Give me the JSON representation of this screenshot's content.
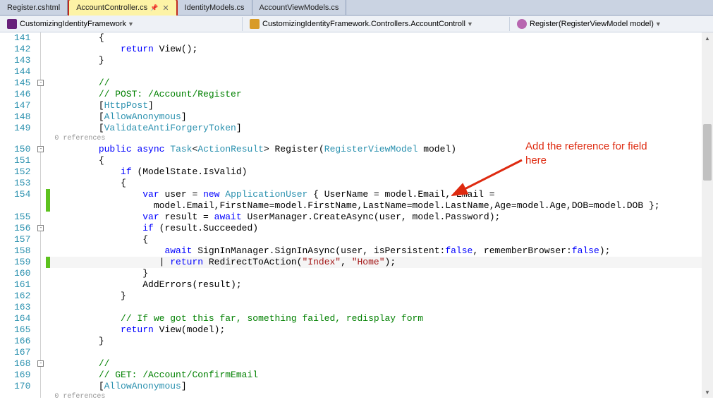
{
  "tabs": [
    {
      "label": "Register.cshtml",
      "active": false
    },
    {
      "label": "AccountController.cs",
      "active": true,
      "pinned": true
    },
    {
      "label": "IdentityModels.cs",
      "active": false
    },
    {
      "label": "AccountViewModels.cs",
      "active": false
    }
  ],
  "nav": {
    "project": "CustomizingIdentityFramework",
    "class": "CustomizingIdentityFramework.Controllers.AccountControll",
    "member": "Register(RegisterViewModel model)"
  },
  "annotation": {
    "line1": "Add the reference for field",
    "line2": "here"
  },
  "lines": [
    {
      "num": 141,
      "code": [
        {
          "t": "n",
          "v": "        {"
        }
      ]
    },
    {
      "num": 142,
      "code": [
        {
          "t": "n",
          "v": "            "
        },
        {
          "t": "k",
          "v": "return"
        },
        {
          "t": "n",
          "v": " View();"
        }
      ]
    },
    {
      "num": 143,
      "code": [
        {
          "t": "n",
          "v": "        }"
        }
      ]
    },
    {
      "num": 144,
      "code": [
        {
          "t": "n",
          "v": ""
        }
      ]
    },
    {
      "num": 145,
      "fold": "-",
      "code": [
        {
          "t": "n",
          "v": "        "
        },
        {
          "t": "c",
          "v": "//"
        }
      ]
    },
    {
      "num": 146,
      "code": [
        {
          "t": "n",
          "v": "        "
        },
        {
          "t": "c",
          "v": "// POST: /Account/Register"
        }
      ]
    },
    {
      "num": 147,
      "code": [
        {
          "t": "n",
          "v": "        ["
        },
        {
          "t": "t",
          "v": "HttpPost"
        },
        {
          "t": "n",
          "v": "]"
        }
      ]
    },
    {
      "num": 148,
      "code": [
        {
          "t": "n",
          "v": "        ["
        },
        {
          "t": "t",
          "v": "AllowAnonymous"
        },
        {
          "t": "n",
          "v": "]"
        }
      ]
    },
    {
      "num": 149,
      "code": [
        {
          "t": "n",
          "v": "        ["
        },
        {
          "t": "t",
          "v": "ValidateAntiForgeryToken"
        },
        {
          "t": "n",
          "v": "]"
        }
      ]
    },
    {
      "refs": "0 references"
    },
    {
      "num": 150,
      "fold": "-",
      "code": [
        {
          "t": "n",
          "v": "        "
        },
        {
          "t": "k",
          "v": "public"
        },
        {
          "t": "n",
          "v": " "
        },
        {
          "t": "k",
          "v": "async"
        },
        {
          "t": "n",
          "v": " "
        },
        {
          "t": "t",
          "v": "Task"
        },
        {
          "t": "n",
          "v": "<"
        },
        {
          "t": "t",
          "v": "ActionResult"
        },
        {
          "t": "n",
          "v": "> Register("
        },
        {
          "t": "t",
          "v": "RegisterViewModel"
        },
        {
          "t": "n",
          "v": " model)"
        }
      ]
    },
    {
      "num": 151,
      "code": [
        {
          "t": "n",
          "v": "        {"
        }
      ]
    },
    {
      "num": 152,
      "code": [
        {
          "t": "n",
          "v": "            "
        },
        {
          "t": "k",
          "v": "if"
        },
        {
          "t": "n",
          "v": " (ModelState.IsValid)"
        }
      ]
    },
    {
      "num": 153,
      "code": [
        {
          "t": "n",
          "v": "            {"
        }
      ]
    },
    {
      "num": 154,
      "changed": true,
      "code": [
        {
          "t": "n",
          "v": "                "
        },
        {
          "t": "k",
          "v": "var"
        },
        {
          "t": "n",
          "v": " user = "
        },
        {
          "t": "k",
          "v": "new"
        },
        {
          "t": "n",
          "v": " "
        },
        {
          "t": "t",
          "v": "ApplicationUser"
        },
        {
          "t": "n",
          "v": " { UserName = model.Email, Email = "
        }
      ]
    },
    {
      "num": null,
      "changed": true,
      "code": [
        {
          "t": "n",
          "v": "                  model.Email,FirstName=model.FirstName,LastName=model.LastName,Age=model.Age,DOB=model.DOB };"
        }
      ]
    },
    {
      "num": 155,
      "code": [
        {
          "t": "n",
          "v": "                "
        },
        {
          "t": "k",
          "v": "var"
        },
        {
          "t": "n",
          "v": " result = "
        },
        {
          "t": "k",
          "v": "await"
        },
        {
          "t": "n",
          "v": " UserManager.CreateAsync(user, model.Password);"
        }
      ]
    },
    {
      "num": 156,
      "fold": "-",
      "code": [
        {
          "t": "n",
          "v": "                "
        },
        {
          "t": "k",
          "v": "if"
        },
        {
          "t": "n",
          "v": " (result.Succeeded)"
        }
      ]
    },
    {
      "num": 157,
      "code": [
        {
          "t": "n",
          "v": "                {"
        }
      ]
    },
    {
      "num": 158,
      "code": [
        {
          "t": "n",
          "v": "                    "
        },
        {
          "t": "k",
          "v": "await"
        },
        {
          "t": "n",
          "v": " SignInManager.SignInAsync(user, isPersistent:"
        },
        {
          "t": "k",
          "v": "false"
        },
        {
          "t": "n",
          "v": ", rememberBrowser:"
        },
        {
          "t": "k",
          "v": "false"
        },
        {
          "t": "n",
          "v": ");"
        }
      ]
    },
    {
      "num": 159,
      "changed": true,
      "active": true,
      "code": [
        {
          "t": "n",
          "v": "                   | "
        },
        {
          "t": "k",
          "v": "return"
        },
        {
          "t": "n",
          "v": " RedirectToAction("
        },
        {
          "t": "s",
          "v": "\"Index\""
        },
        {
          "t": "n",
          "v": ", "
        },
        {
          "t": "s",
          "v": "\"Home\""
        },
        {
          "t": "n",
          "v": ");"
        }
      ]
    },
    {
      "num": 160,
      "code": [
        {
          "t": "n",
          "v": "                }"
        }
      ]
    },
    {
      "num": 161,
      "code": [
        {
          "t": "n",
          "v": "                AddErrors(result);"
        }
      ]
    },
    {
      "num": 162,
      "code": [
        {
          "t": "n",
          "v": "            }"
        }
      ]
    },
    {
      "num": 163,
      "code": [
        {
          "t": "n",
          "v": ""
        }
      ]
    },
    {
      "num": 164,
      "code": [
        {
          "t": "n",
          "v": "            "
        },
        {
          "t": "c",
          "v": "// If we got this far, something failed, redisplay form"
        }
      ]
    },
    {
      "num": 165,
      "code": [
        {
          "t": "n",
          "v": "            "
        },
        {
          "t": "k",
          "v": "return"
        },
        {
          "t": "n",
          "v": " View(model);"
        }
      ]
    },
    {
      "num": 166,
      "code": [
        {
          "t": "n",
          "v": "        }"
        }
      ]
    },
    {
      "num": 167,
      "code": [
        {
          "t": "n",
          "v": ""
        }
      ]
    },
    {
      "num": 168,
      "fold": "-",
      "code": [
        {
          "t": "n",
          "v": "        "
        },
        {
          "t": "c",
          "v": "//"
        }
      ]
    },
    {
      "num": 169,
      "code": [
        {
          "t": "n",
          "v": "        "
        },
        {
          "t": "c",
          "v": "// GET: /Account/ConfirmEmail"
        }
      ]
    },
    {
      "num": 170,
      "code": [
        {
          "t": "n",
          "v": "        ["
        },
        {
          "t": "t",
          "v": "AllowAnonymous"
        },
        {
          "t": "n",
          "v": "]"
        }
      ]
    },
    {
      "refs": "0 references"
    }
  ]
}
